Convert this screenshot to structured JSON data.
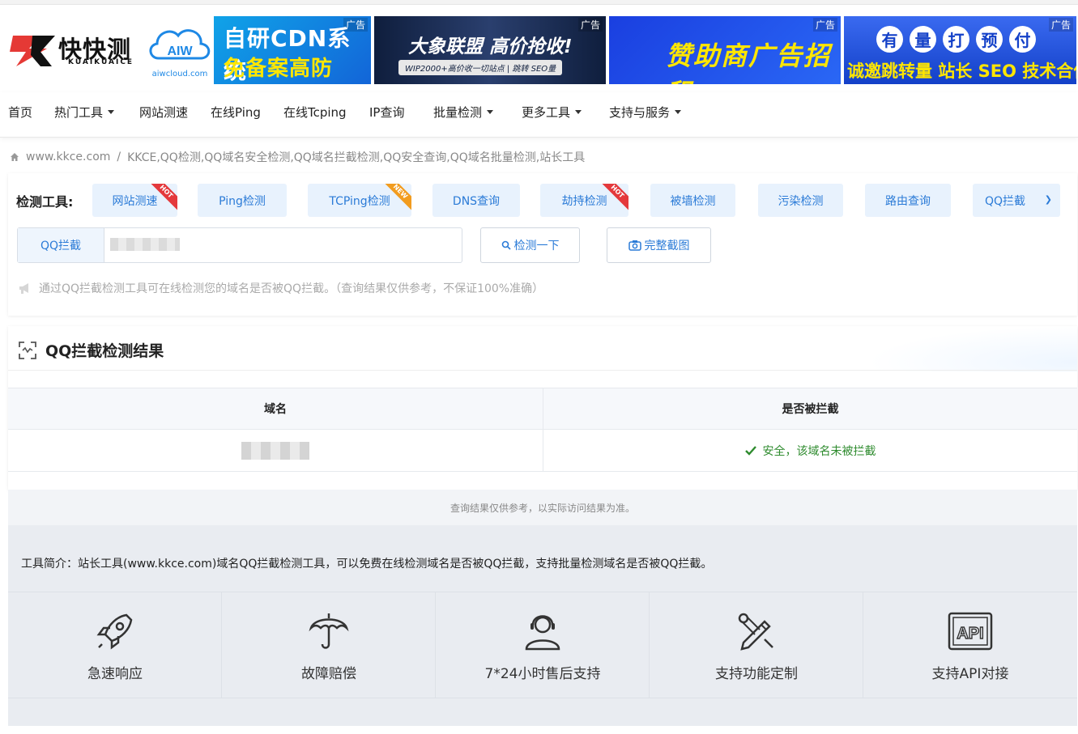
{
  "header": {
    "logo_cn": "快快测",
    "logo_en": "KUAIKUAICE",
    "partner_logo_text": "aiwcloud.com",
    "ads": [
      {
        "tag": "广告",
        "line1": "自研CDN系统",
        "line2": "免备案高防CDN"
      },
      {
        "tag": "广告",
        "line1": "大象联盟 高价抢收!",
        "line2": "WIP2000+高价收一切站点 | 跳转 SEO量"
      },
      {
        "tag": "广告",
        "line1": "赞助商广告招租"
      },
      {
        "tag": "广告",
        "chars": [
          "有",
          "量",
          "打",
          "预",
          "付"
        ],
        "line2": "诚邀跳转量 站长 SEO 技术合作"
      }
    ]
  },
  "nav": {
    "items": [
      {
        "label": "首页"
      },
      {
        "label": "热门工具"
      },
      {
        "label": "网站测速"
      },
      {
        "label": "在线Ping"
      },
      {
        "label": "在线Tcping"
      },
      {
        "label": "IP查询"
      },
      {
        "label": "批量检测"
      },
      {
        "label": "更多工具"
      },
      {
        "label": "支持与服务"
      }
    ]
  },
  "breadcrumb": {
    "home": "www.kkce.com",
    "sep": "/",
    "current": "KKCE,QQ检测,QQ域名安全检测,QQ域名拦截检测,QQ安全查询,QQ域名批量检测,站长工具"
  },
  "tools": {
    "label": "检测工具:",
    "buttons": [
      {
        "label": "网站测速",
        "badge": "HOT"
      },
      {
        "label": "Ping检测"
      },
      {
        "label": "TCPing检测",
        "badge": "NEW"
      },
      {
        "label": "DNS查询"
      },
      {
        "label": "劫持检测",
        "badge": "HOT"
      },
      {
        "label": "被墙检测"
      },
      {
        "label": "污染检测"
      },
      {
        "label": "路由查询"
      }
    ],
    "select_value": "QQ拦截",
    "input_addon": "QQ拦截",
    "input_value": "",
    "check_button": "检测一下",
    "screenshot_button": "完整截图",
    "hint": "通过QQ拦截检测工具可在线检测您的域名是否被QQ拦截。（查询结果仅供参考，不保证100%准确）"
  },
  "result": {
    "title": "QQ拦截检测结果",
    "columns": [
      "域名",
      "是否被拦截"
    ],
    "rows": [
      {
        "domain": "",
        "status": "安全，该域名未被拦截"
      }
    ],
    "footnote": "查询结果仅供参考，以实际访问结果为准。"
  },
  "intro": {
    "text": "工具简介：站长工具(www.kkce.com)域名QQ拦截检测工具，可以免费在线检测域名是否被QQ拦截，支持批量检测域名是否被QQ拦截。",
    "features": [
      {
        "label": "急速响应",
        "icon": "rocket-icon"
      },
      {
        "label": "故障赔偿",
        "icon": "umbrella-icon"
      },
      {
        "label": "7*24小时售后支持",
        "icon": "support-agent-icon"
      },
      {
        "label": "支持功能定制",
        "icon": "tools-icon"
      },
      {
        "label": "支持API对接",
        "icon": "api-icon"
      }
    ]
  },
  "colors": {
    "accent": "#2b7bd7",
    "tool_bg": "#e8f2fd",
    "hot": "#e4393c",
    "new": "#f29c1f",
    "safe": "#2e8b2e"
  }
}
